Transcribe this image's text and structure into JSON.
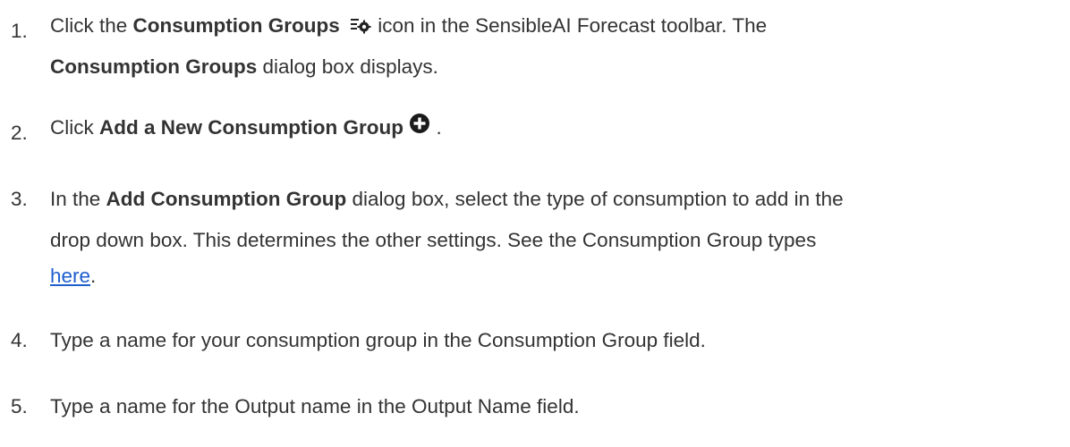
{
  "steps": [
    {
      "number": "1.",
      "parts": {
        "a": "Click the ",
        "b_bold": "Consumption Groups",
        "c": " icon in the SensibleAI Forecast toolbar. The",
        "d_bold": "Consumption Groups",
        "e": " dialog box displays."
      },
      "icon": "consumption-groups-icon"
    },
    {
      "number": "2.",
      "parts": {
        "a": "Click ",
        "b_bold": "Add a New Consumption Group",
        "c": " ."
      },
      "icon": "add-circle-icon"
    },
    {
      "number": "3.",
      "parts": {
        "a": "In the ",
        "b_bold": "Add Consumption Group",
        "c": " dialog box, select the type of consumption to add in the",
        "d": "drop down box. This determines the other settings. See the Consumption Group types",
        "link": "here",
        "e": "."
      }
    },
    {
      "number": "4.",
      "text": "Type a name for your consumption group in the Consumption Group field."
    },
    {
      "number": "5.",
      "text": "Type a name for the Output name in the Output Name field."
    }
  ],
  "colors": {
    "text": "#333333",
    "link": "#1f5fcc"
  }
}
